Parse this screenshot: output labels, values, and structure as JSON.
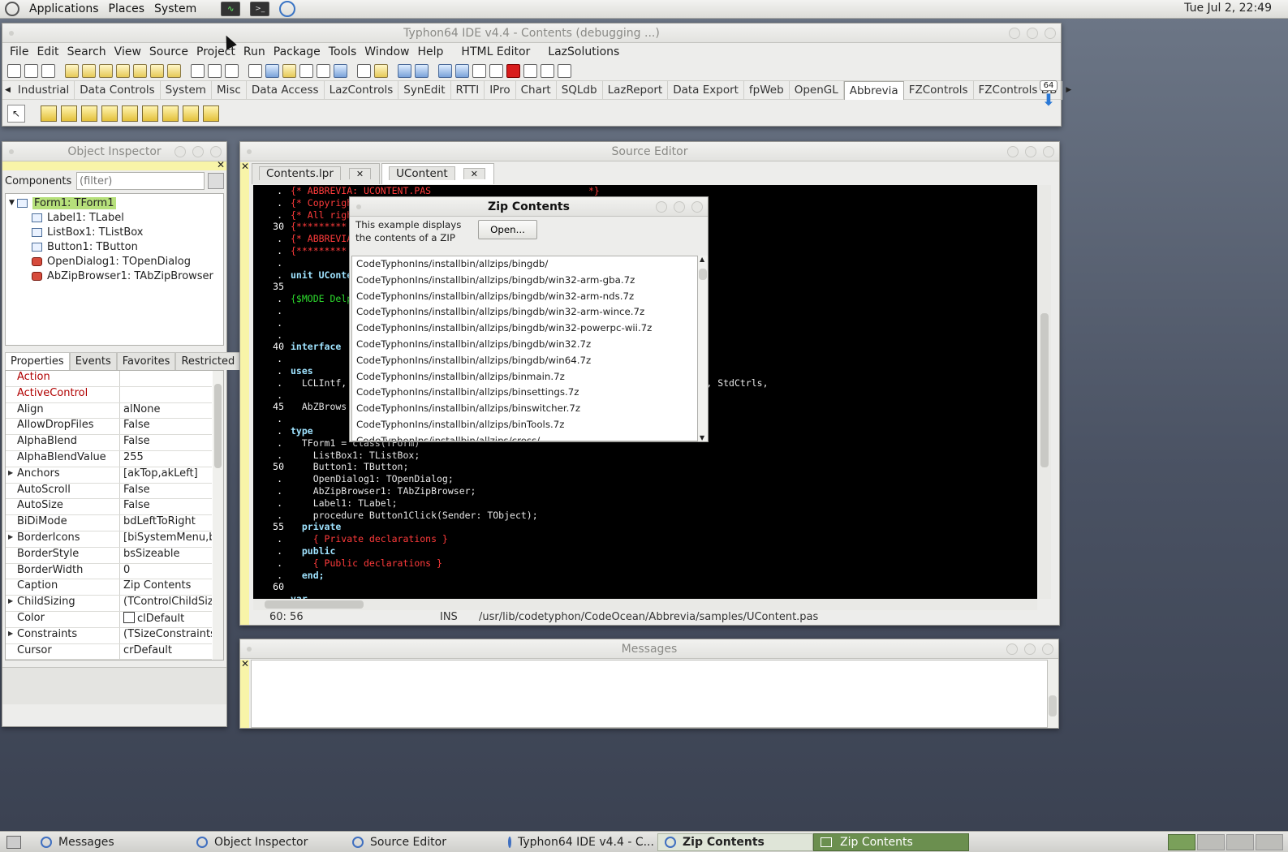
{
  "topbar": {
    "menus": [
      "Applications",
      "Places",
      "System"
    ],
    "clock": "Tue Jul  2, 22:49"
  },
  "ide": {
    "title": "Typhon64 IDE v4.4 - Contents (debugging ...)",
    "menu": [
      "File",
      "Edit",
      "Search",
      "View",
      "Source",
      "Project",
      "Run",
      "Package",
      "Tools",
      "Window",
      "Help",
      "HTML Editor",
      "LazSolutions"
    ],
    "palette": [
      "Industrial",
      "Data Controls",
      "System",
      "Misc",
      "Data Access",
      "LazControls",
      "SynEdit",
      "RTTI",
      "IPro",
      "Chart",
      "SQLdb",
      "LazReport",
      "Data Export",
      "fpWeb",
      "OpenGL",
      "Abbrevia",
      "FZControls",
      "FZControls DB"
    ],
    "palette_active": "Abbrevia",
    "badge": "64"
  },
  "inspector": {
    "title": "Object Inspector",
    "components_label": "Components",
    "filter_placeholder": "(filter)",
    "tree": [
      {
        "label": "Form1: TForm1",
        "icon": "form-icon"
      },
      {
        "label": "Label1: TLabel",
        "icon": "label-icon"
      },
      {
        "label": "ListBox1: TListBox",
        "icon": "listbox-icon"
      },
      {
        "label": "Button1: TButton",
        "icon": "button-icon"
      },
      {
        "label": "OpenDialog1: TOpenDialog",
        "icon": "dialog-icon"
      },
      {
        "label": "AbZipBrowser1: TAbZipBrowser",
        "icon": "zip-icon"
      }
    ],
    "tabs": [
      "Properties",
      "Events",
      "Favorites",
      "Restricted"
    ],
    "props": [
      {
        "name": "Action",
        "value": "",
        "red": true
      },
      {
        "name": "ActiveControl",
        "value": "",
        "red": true
      },
      {
        "name": "Align",
        "value": "alNone"
      },
      {
        "name": "AllowDropFiles",
        "value": "False"
      },
      {
        "name": "AlphaBlend",
        "value": "False"
      },
      {
        "name": "AlphaBlendValue",
        "value": "255"
      },
      {
        "name": "Anchors",
        "value": "[akTop,akLeft]",
        "expand": true
      },
      {
        "name": "AutoScroll",
        "value": "False"
      },
      {
        "name": "AutoSize",
        "value": "False"
      },
      {
        "name": "BiDiMode",
        "value": "bdLeftToRight"
      },
      {
        "name": "BorderIcons",
        "value": "[biSystemMenu,bi",
        "expand": true
      },
      {
        "name": "BorderStyle",
        "value": "bsSizeable"
      },
      {
        "name": "BorderWidth",
        "value": "0"
      },
      {
        "name": "Caption",
        "value": "Zip Contents"
      },
      {
        "name": "ChildSizing",
        "value": "(TControlChildSizin",
        "expand": true
      },
      {
        "name": "Color",
        "value": "clDefault",
        "swatch": true
      },
      {
        "name": "Constraints",
        "value": "(TSizeConstraints)",
        "expand": true
      },
      {
        "name": "Cursor",
        "value": "crDefault"
      }
    ]
  },
  "editor": {
    "title": "Source Editor",
    "tabs": [
      "Contents.lpr",
      "UContent"
    ],
    "active_tab": "UContent",
    "lines": [
      {
        "n": ".",
        "t": "{* ABBREVIA: UCONTENT.PAS                            *}",
        "c": "cm"
      },
      {
        "n": ".",
        "t": "{* Copyright",
        "c": "cm"
      },
      {
        "n": ".",
        "t": "{* All righ",
        "c": "cm"
      },
      {
        "n": "30",
        "t": "{*********",
        "c": "cm"
      },
      {
        "n": ".",
        "t": "{* ABBREVIA",
        "c": "cm"
      },
      {
        "n": ".",
        "t": "{*********",
        "c": "cm"
      },
      {
        "n": ".",
        "t": "",
        "c": ""
      },
      {
        "n": ".",
        "t": "unit UConte",
        "c": "kw"
      },
      {
        "n": "35",
        "t": "",
        "c": ""
      },
      {
        "n": ".",
        "t": "{$MODE Delp",
        "c": "dr"
      },
      {
        "n": ".",
        "t": "",
        "c": ""
      },
      {
        "n": ".",
        "t": "",
        "c": ""
      },
      {
        "n": ".",
        "t": "",
        "c": ""
      },
      {
        "n": "40",
        "t": "interface",
        "c": "kw"
      },
      {
        "n": ".",
        "t": "",
        "c": ""
      },
      {
        "n": ".",
        "t": "uses",
        "c": "kw"
      },
      {
        "n": ".",
        "t": "  LCLIntf,                                            rols, Forms, Dialogs, StdCtrls,",
        "c": "ty"
      },
      {
        "n": ".",
        "t": "",
        "c": ""
      },
      {
        "n": "45",
        "t": "  AbZBrows",
        "c": "ty"
      },
      {
        "n": ".",
        "t": "",
        "c": ""
      },
      {
        "n": ".",
        "t": "type",
        "c": "kw"
      },
      {
        "n": ".",
        "t": "  TForm1 = class(TForm)",
        "c": "ty"
      },
      {
        "n": ".",
        "t": "    ListBox1: TListBox;",
        "c": "ty"
      },
      {
        "n": "50",
        "t": "    Button1: TButton;",
        "c": "ty"
      },
      {
        "n": ".",
        "t": "    OpenDialog1: TOpenDialog;",
        "c": "ty"
      },
      {
        "n": ".",
        "t": "    AbZipBrowser1: TAbZipBrowser;",
        "c": "ty"
      },
      {
        "n": ".",
        "t": "    Label1: TLabel;",
        "c": "ty"
      },
      {
        "n": ".",
        "t": "    procedure Button1Click(Sender: TObject);",
        "c": "ty"
      },
      {
        "n": "55",
        "t": "  private",
        "c": "kw"
      },
      {
        "n": ".",
        "t": "    { Private declarations }",
        "c": "cm"
      },
      {
        "n": ".",
        "t": "  public",
        "c": "kw"
      },
      {
        "n": ".",
        "t": "    { Public declarations }",
        "c": "cm"
      },
      {
        "n": ".",
        "t": "  end;",
        "c": "kw"
      },
      {
        "n": "60",
        "t": "",
        "c": ""
      },
      {
        "n": ".",
        "t": "var",
        "c": "kw"
      }
    ],
    "status_pos": "60: 56",
    "status_mode": "INS",
    "status_path": "/usr/lib/codetyphon/CodeOcean/Abbrevia/samples/UContent.pas"
  },
  "zip": {
    "title": "Zip Contents",
    "label": "This example displays the contents of a ZIP",
    "open_button": "Open...",
    "items": [
      "CodeTyphonIns/installbin/allzips/bingdb/",
      "CodeTyphonIns/installbin/allzips/bingdb/win32-arm-gba.7z",
      "CodeTyphonIns/installbin/allzips/bingdb/win32-arm-nds.7z",
      "CodeTyphonIns/installbin/allzips/bingdb/win32-arm-wince.7z",
      "CodeTyphonIns/installbin/allzips/bingdb/win32-powerpc-wii.7z",
      "CodeTyphonIns/installbin/allzips/bingdb/win32.7z",
      "CodeTyphonIns/installbin/allzips/bingdb/win64.7z",
      "CodeTyphonIns/installbin/allzips/binmain.7z",
      "CodeTyphonIns/installbin/allzips/binsettings.7z",
      "CodeTyphonIns/installbin/allzips/binswitcher.7z",
      "CodeTyphonIns/installbin/allzips/binTools.7z",
      "CodeTyphonIns/installbin/allzips/cross/"
    ]
  },
  "messages": {
    "title": "Messages"
  },
  "taskbar": {
    "items": [
      "Messages",
      "Object Inspector",
      "Source Editor",
      "Typhon64 IDE v4.4 - C...",
      "Zip Contents",
      "Zip Contents"
    ]
  }
}
